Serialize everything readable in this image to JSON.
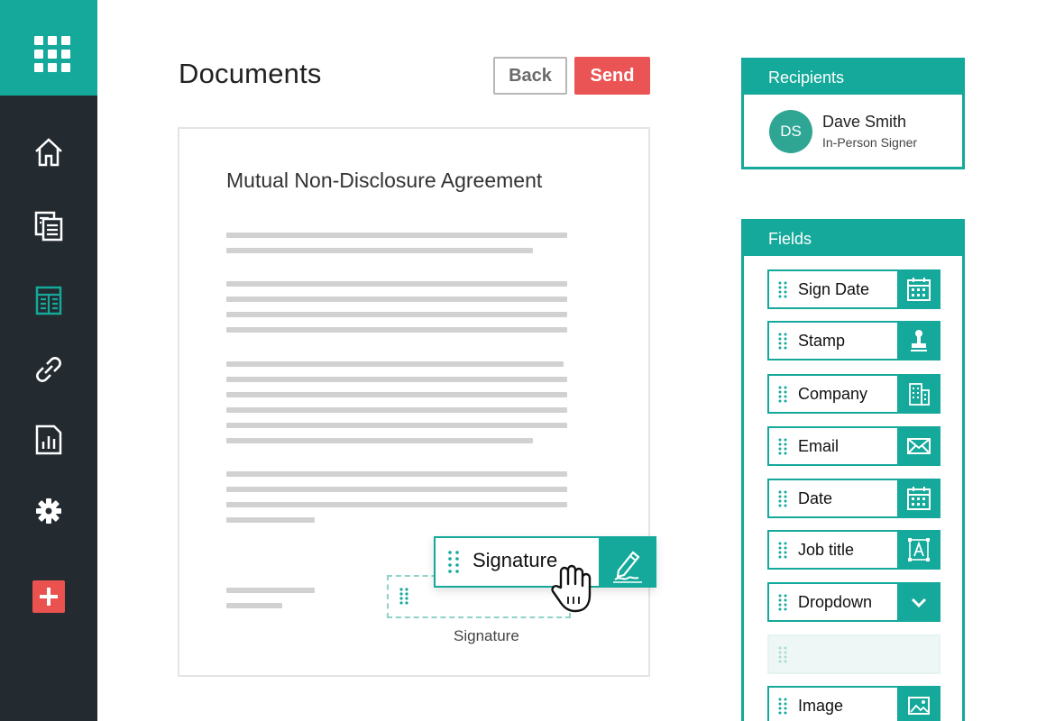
{
  "header": {
    "title": "Documents",
    "back_label": "Back",
    "send_label": "Send"
  },
  "document": {
    "title": "Mutual Non-Disclosure Agreement"
  },
  "signature": {
    "drag_label": "Signature",
    "caption": "Signature"
  },
  "recipients": {
    "heading": "Recipients",
    "items": [
      {
        "initials": "DS",
        "name": "Dave Smith",
        "role": "In-Person Signer"
      }
    ]
  },
  "fields": {
    "heading": "Fields",
    "items": [
      {
        "label": "Sign Date",
        "icon": "calendar-icon"
      },
      {
        "label": "Stamp",
        "icon": "stamp-icon"
      },
      {
        "label": "Company",
        "icon": "building-icon"
      },
      {
        "label": "Email",
        "icon": "envelope-icon"
      },
      {
        "label": "Date",
        "icon": "calendar-icon"
      },
      {
        "label": "Job title",
        "icon": "text-box-icon"
      },
      {
        "label": "Dropdown",
        "icon": "chevron-down-icon"
      },
      {
        "label": "",
        "icon": ""
      },
      {
        "label": "Image",
        "icon": "image-icon"
      }
    ]
  },
  "sidebar": {
    "items": [
      {
        "icon": "home-icon"
      },
      {
        "icon": "documents-icon"
      },
      {
        "icon": "templates-icon"
      },
      {
        "icon": "link-icon"
      },
      {
        "icon": "report-icon"
      },
      {
        "icon": "gear-icon"
      },
      {
        "icon": "add-icon"
      }
    ]
  },
  "colors": {
    "accent": "#14a99a",
    "sidebar": "#232a30",
    "send": "#eb5454",
    "add": "#e9524f"
  }
}
